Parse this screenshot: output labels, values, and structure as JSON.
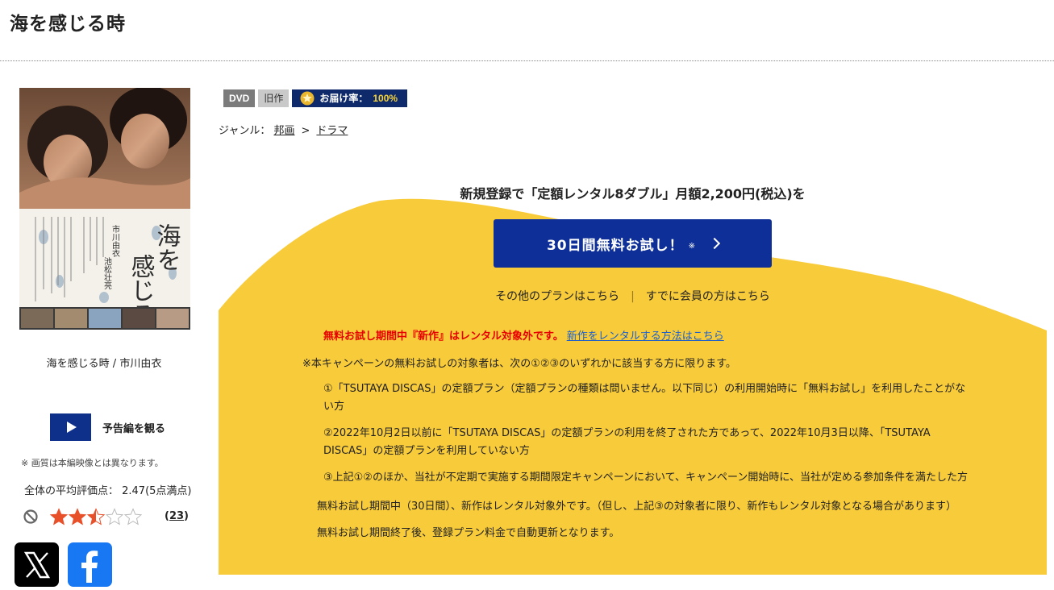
{
  "page": {
    "title": "海を感じる時"
  },
  "product": {
    "caption": "海を感じる時 / 市川由衣",
    "badges": {
      "format": "DVD",
      "age": "旧作",
      "delivery": "お届け率：",
      "delivery_value": "100%"
    },
    "genre": {
      "label": "ジャンル：",
      "items": [
        "邦画",
        "ドラマ"
      ],
      "separator": ">"
    }
  },
  "cover_text": {
    "title_col1": "海を",
    "title_col2": "感じる時",
    "cast1": "市川由衣",
    "cast2": "池松壮亮"
  },
  "trailer": {
    "label": "予告編を観る"
  },
  "quality_note": "※ 画質は本編映像とは異なります。",
  "rating": {
    "average_text": "全体の平均評価点： 2.47(5点満点)",
    "stars": 2.5,
    "count": "23",
    "star_color": "#e8502a"
  },
  "social": {
    "x": "x-logo",
    "facebook": "facebook-logo"
  },
  "promo": {
    "headline": "新規登録で「定額レンタル8ダブル」月額2,200円(税込)を",
    "cta_label": "30日間無料お試し！",
    "cta_mark": "※",
    "other_plans": "その他のプランはこちら",
    "members": "すでに会員の方はこちら",
    "separator": "|",
    "warning": "無料お試し期間中『新作』はレンタル対象外です。",
    "warning_link": "新作をレンタルする方法はこちら",
    "campaign_note": "※本キャンペーンの無料お試しの対象者は、次の①②③のいずれかに該当する方に限ります。",
    "conditions": [
      "①「TSUTAYA DISCAS」の定額プラン（定額プランの種類は問いません。以下同じ）の利用開始時に「無料お試し」を利用したことがない方",
      "②2022年10月2日以前に「TSUTAYA DISCAS」の定額プランの利用を終了された方であって、2022年10月3日以降、「TSUTAYA DISCAS」の定額プランを利用していない方",
      "③上記①②のほか、当社が不定期で実施する期間限定キャンペーンにおいて、キャンペーン開始時に、当社が定める参加条件を満たした方"
    ],
    "foot1": "無料お試し期間中（30日間）、新作はレンタル対象外です。（但し、上記③の対象者に限り、新作もレンタル対象となる場合があります）",
    "foot2": "無料お試し期間終了後、登録プラン料金で自動更新となります。",
    "colors": {
      "bg": "#f8cb3b",
      "button": "#0e2f97",
      "warning": "#e60000"
    }
  }
}
